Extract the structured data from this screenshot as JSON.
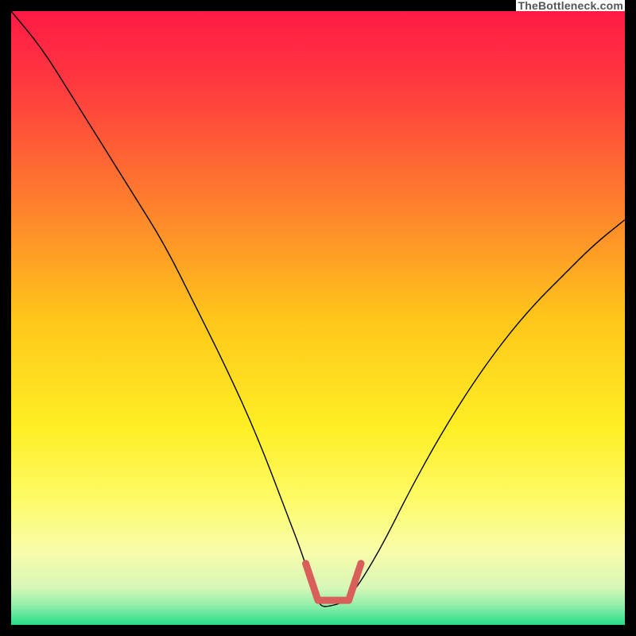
{
  "watermark": "TheBottleneck.com",
  "chart_data": {
    "type": "line",
    "title": "",
    "xlabel": "",
    "ylabel": "",
    "xlim": [
      0,
      100
    ],
    "ylim": [
      0,
      100
    ],
    "grid": false,
    "legend": false,
    "background_gradient": {
      "stops": [
        {
          "offset": 0.0,
          "color": "#ff1a45"
        },
        {
          "offset": 0.12,
          "color": "#ff3a3f"
        },
        {
          "offset": 0.3,
          "color": "#ff7a2f"
        },
        {
          "offset": 0.5,
          "color": "#ffc61a"
        },
        {
          "offset": 0.68,
          "color": "#ffef25"
        },
        {
          "offset": 0.8,
          "color": "#fdfb6a"
        },
        {
          "offset": 0.88,
          "color": "#f8fca9"
        },
        {
          "offset": 0.94,
          "color": "#d6f7b8"
        },
        {
          "offset": 0.97,
          "color": "#8ceea8"
        },
        {
          "offset": 1.0,
          "color": "#25dd88"
        }
      ]
    },
    "series": [
      {
        "name": "bottleneck-curve",
        "stroke": "#000000",
        "stroke_width": 1.4,
        "x": [
          0,
          5,
          10,
          15,
          20,
          25,
          30,
          35,
          40,
          45,
          48,
          50,
          52,
          55,
          60,
          65,
          70,
          75,
          80,
          85,
          90,
          95,
          100
        ],
        "y": [
          100,
          94,
          86,
          78,
          70,
          62,
          52,
          42,
          31,
          18,
          10,
          3,
          3,
          4,
          12,
          22,
          31,
          39,
          46,
          52,
          57,
          62,
          66
        ]
      },
      {
        "name": "optimal-band",
        "stroke": "#d9605a",
        "stroke_width": 9,
        "linecap": "round",
        "x": [
          48,
          50,
          55,
          57
        ],
        "y": [
          10,
          4,
          4,
          10
        ]
      }
    ],
    "annotations": []
  }
}
